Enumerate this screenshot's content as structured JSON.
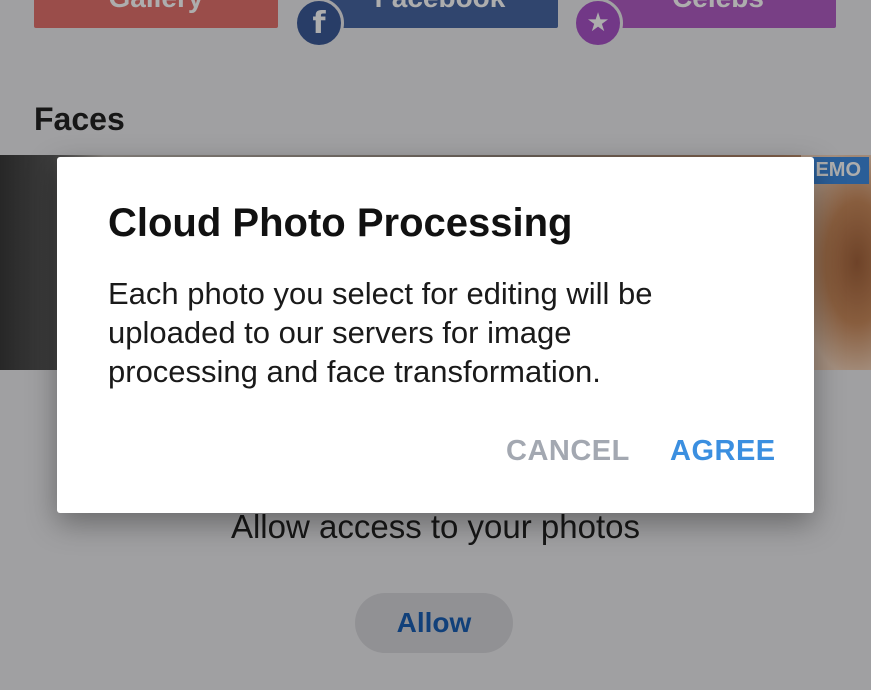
{
  "sources": {
    "gallery_label": "Gallery",
    "facebook_label": "Facebook",
    "celebs_label": "Celebs",
    "facebook_icon": "f",
    "celebs_icon": "★"
  },
  "faces": {
    "title": "Faces",
    "demo_badge": "EMO"
  },
  "permission": {
    "text": "Allow access to your photos",
    "allow_label": "Allow"
  },
  "dialog": {
    "title": "Cloud Photo Processing",
    "body": "Each photo you select for editing will be uploaded to our servers for image processing and face transformation.",
    "cancel_label": "CANCEL",
    "agree_label": "AGREE"
  },
  "colors": {
    "accent": "#3b8fe0",
    "cancel": "#a3a8b1",
    "gallery": "#e4726e",
    "facebook": "#4866a3",
    "celebs": "#b15ec4"
  }
}
